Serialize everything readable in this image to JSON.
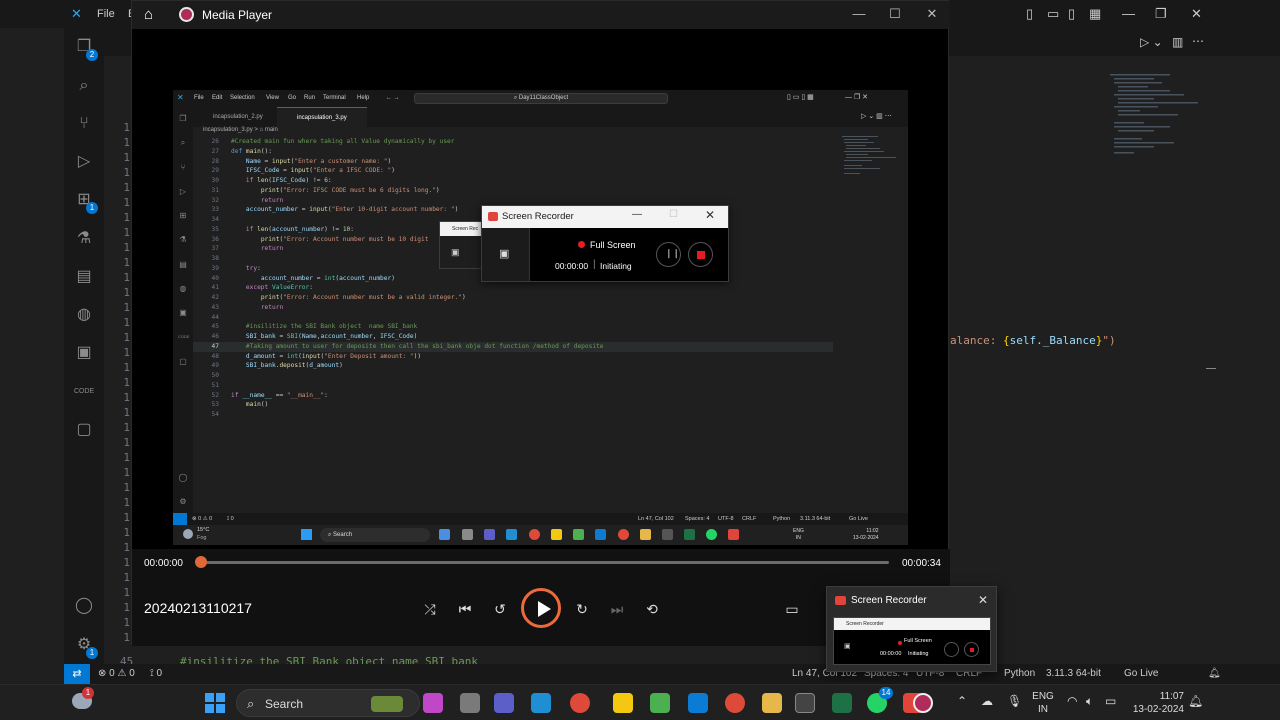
{
  "bg_vscode": {
    "menu_file": "File",
    "menu_edit_partial": "E",
    "line_numbers": [
      "1",
      "1",
      "1",
      "1",
      "1",
      "1",
      "1",
      "1",
      "1",
      "1",
      "1",
      "1",
      "1",
      "1",
      "1",
      "1",
      "1",
      "1",
      "1",
      "1",
      "1",
      "1",
      "1",
      "1",
      "1",
      "1",
      "1",
      "1",
      "1",
      "1",
      "1",
      "1",
      "1",
      "1",
      "1"
    ],
    "code_right": {
      "prefix": "alance: ",
      "brace_open": "{",
      "var": "self._Balance",
      "brace_close": "}",
      "suffix": "\")"
    },
    "line_45": "45",
    "comment_45": "#insilitize the SBI Bank object  name SBI bank",
    "status": {
      "problems": "⊗ 0 ⚠ 0",
      "ports": "⟟ 0",
      "position": "Ln 47, Col 102",
      "spaces": "Spaces: 4",
      "encoding": "UTF-8",
      "eol": "CRLF",
      "language": "Python",
      "interpreter": "3.11.3 64-bit",
      "golive": "Go Live"
    },
    "activity_badges": {
      "explorer": "2",
      "extensions": "1",
      "settings": "1"
    }
  },
  "taskbar": {
    "search_label": "Search",
    "lang_top": "ENG",
    "lang_bottom": "IN",
    "time": "11:07",
    "date": "13-02-2024",
    "teams_badge": "14",
    "weather_badge": "1"
  },
  "media_player": {
    "title": "Media Player",
    "time_current": "00:00:00",
    "time_total": "00:00:34",
    "progress_fraction": 0.0,
    "filename": "20240213110217"
  },
  "inner_vscode": {
    "menus": [
      "File",
      "Edit",
      "Selection",
      "View",
      "Go",
      "Run",
      "Terminal",
      "Help"
    ],
    "search": "Day11ClassObject",
    "tabs": [
      "incapsulation_2.py",
      "incapsulation_3.py"
    ],
    "breadcrumb": "incapsulation_3.py > ⌂ main",
    "status": {
      "problems": "⊗ 0 ⚠ 0",
      "ports": "⟟ 0",
      "position": "Ln 47, Col 102",
      "spaces": "Spaces: 4",
      "encoding": "UTF-8",
      "eol": "CRLF",
      "language": "Python",
      "interpreter": "3.11.3 64-bit",
      "golive": "Go Live"
    },
    "taskbar": {
      "weather_temp": "15°C",
      "weather_desc": "Fog",
      "search": "Search",
      "lang_top": "ENG",
      "lang_bottom": "IN",
      "time": "11:02",
      "date": "13-02-2024"
    }
  },
  "recorder_inner": {
    "title": "Screen Recorder",
    "ghost_title": "Screen Rec",
    "mode": "Full Screen",
    "time": "00:00:00",
    "state": "Initiating"
  },
  "recorder_popup": {
    "title": "Screen Recorder",
    "thumb_title": "Screen Recorder",
    "mode": "Full Screen",
    "time": "00:00:00",
    "state": "Initiating"
  },
  "colors": {
    "accent_blue": "#0078d4",
    "record_red": "#e81b23",
    "play_ring": "#ec6a3c"
  },
  "icons": [
    "home-icon",
    "media-player-icon",
    "explorer-icon",
    "search-icon",
    "source-control-icon",
    "run-debug-icon",
    "extensions-icon",
    "testing-icon",
    "docker-icon",
    "account-icon",
    "settings-icon",
    "shuffle-icon",
    "previous-icon",
    "rewind-10-icon",
    "play-icon",
    "forward-30-icon",
    "next-icon",
    "repeat-off-icon",
    "subtitles-icon"
  ]
}
